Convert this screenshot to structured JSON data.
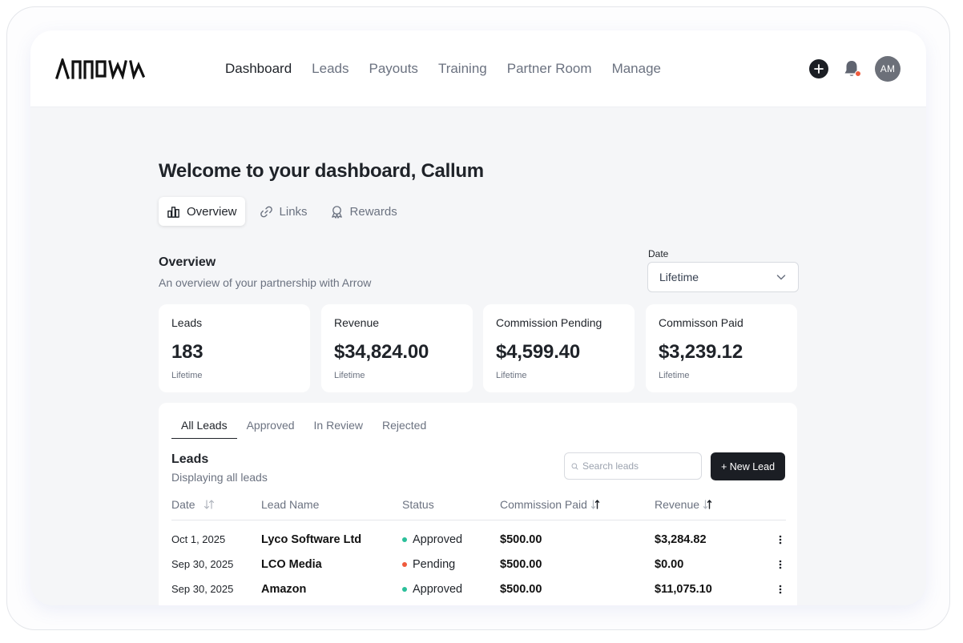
{
  "nav": {
    "links": [
      {
        "label": "Dashboard",
        "active": true
      },
      {
        "label": "Leads",
        "active": false
      },
      {
        "label": "Payouts",
        "active": false
      },
      {
        "label": "Training",
        "active": false
      },
      {
        "label": "Partner Room",
        "active": false
      },
      {
        "label": "Manage",
        "active": false
      }
    ],
    "avatar_initials": "AM",
    "notification_color": "#ef5a3c"
  },
  "welcome": "Welcome to your dashboard, Callum",
  "tabs": [
    {
      "label": "Overview",
      "icon": "bar-chart-icon",
      "active": true
    },
    {
      "label": "Links",
      "icon": "link-icon",
      "active": false
    },
    {
      "label": "Rewards",
      "icon": "award-icon",
      "active": false
    }
  ],
  "overview": {
    "title": "Overview",
    "subtitle": "An overview of your partnership with Arrow",
    "date_label": "Date",
    "date_value": "Lifetime"
  },
  "stats": [
    {
      "label": "Leads",
      "value": "183",
      "note": "Lifetime"
    },
    {
      "label": "Revenue",
      "value": "$34,824.00",
      "note": "Lifetime"
    },
    {
      "label": "Commission Pending",
      "value": "$4,599.40",
      "note": "Lifetime"
    },
    {
      "label": "Commisson Paid",
      "value": "$3,239.12",
      "note": "Lifetime"
    }
  ],
  "leads": {
    "tabs": [
      {
        "label": "All Leads",
        "active": true
      },
      {
        "label": "Approved",
        "active": false
      },
      {
        "label": "In Review",
        "active": false
      },
      {
        "label": "Rejected",
        "active": false
      }
    ],
    "title": "Leads",
    "subtitle": "Displaying all leads",
    "search_placeholder": "Search leads",
    "new_lead_label": "+ New Lead",
    "columns": [
      "Date",
      "Lead Name",
      "Status",
      "Commission Paid",
      "Revenue"
    ],
    "rows": [
      {
        "date": "Oct 1, 2025",
        "name": "Lyco Software Ltd",
        "status": "Approved",
        "status_color": "#2bbf9a",
        "commission": "$500.00",
        "revenue": "$3,284.82"
      },
      {
        "date": "Sep 30, 2025",
        "name": "LCO Media",
        "status": "Pending",
        "status_color": "#ef5a3c",
        "commission": "$500.00",
        "revenue": "$0.00"
      },
      {
        "date": "Sep 30, 2025",
        "name": "Amazon",
        "status": "Approved",
        "status_color": "#2bbf9a",
        "commission": "$500.00",
        "revenue": "$11,075.10"
      }
    ]
  }
}
